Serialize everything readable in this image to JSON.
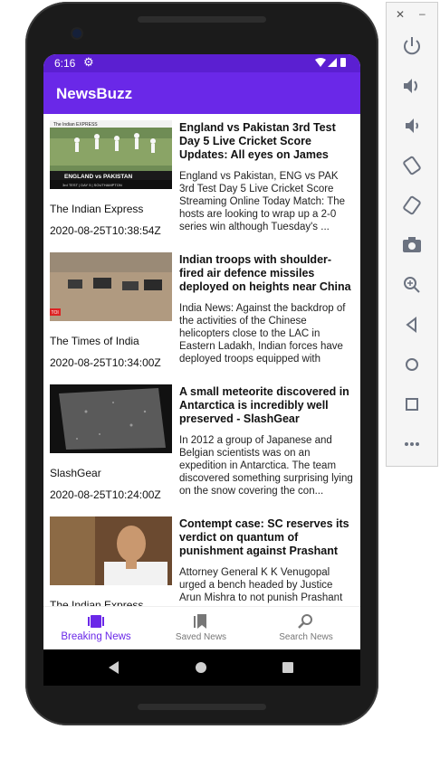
{
  "statusbar": {
    "time": "6:16",
    "settings_icon": "gear-icon"
  },
  "app": {
    "title": "NewsBuzz"
  },
  "articles": [
    {
      "headline": "England vs Pakistan 3rd Test Day 5 Live Cricket Score Updates: All eyes on James Anderson and t...",
      "description": "England vs Pakistan, ENG vs PAK 3rd Test Day 5 Live Cricket Score Streaming Online Today Match: The hosts are looking to wrap up a 2-0 series win although Tuesday's ...",
      "source": "The Indian Express",
      "date": "2020-08-25T10:38:54Z",
      "thumb": {
        "brand": "The Indian EXPRESS",
        "banner": "ENGLAND vs PAKISTAN",
        "sub": "3rd TEST | DAY 5 | SOUTHAMPTON"
      }
    },
    {
      "headline": "Indian troops with shoulder-fired air defence missiles deployed on heights near China border - ...",
      "description": "India News: Against the backdrop of the activities of the Chinese helicopters close to the LAC in Eastern Ladakh, Indian forces have deployed troops equipped with",
      "source": "The Times of India",
      "date": "2020-08-25T10:34:00Z",
      "thumb": {
        "badge": "TOI"
      }
    },
    {
      "headline": "A small meteorite discovered in Antarctica is incredibly well preserved - SlashGear",
      "description": "In 2012 a group of Japanese and Belgian scientists was on an expedition in Antarctica. The team discovered something surprising lying on the snow covering the con...",
      "source": "SlashGear",
      "date": "2020-08-25T10:24:00Z"
    },
    {
      "headline": "Contempt case: SC reserves its verdict on quantum of punishment against Prashant B...",
      "description": "Attorney General K K Venugopal urged a bench headed by Justice Arun Mishra to not punish Prashant",
      "source": "The Indian Express",
      "date": ""
    }
  ],
  "bottom_nav": [
    {
      "label": "Breaking News",
      "icon": "breaking-news-icon",
      "active": true
    },
    {
      "label": "Saved News",
      "icon": "bookmark-icon",
      "active": false
    },
    {
      "label": "Search News",
      "icon": "search-icon",
      "active": false
    }
  ],
  "colors": {
    "primary": "#6a28e8",
    "status": "#5b1fd1",
    "inactive": "#777777"
  },
  "emulator_toolbar": [
    "power-icon",
    "volume-up-icon",
    "volume-down-icon",
    "rotate-left-icon",
    "rotate-right-icon",
    "camera-icon",
    "zoom-icon",
    "back-icon",
    "home-icon",
    "overview-icon",
    "more-icon"
  ]
}
